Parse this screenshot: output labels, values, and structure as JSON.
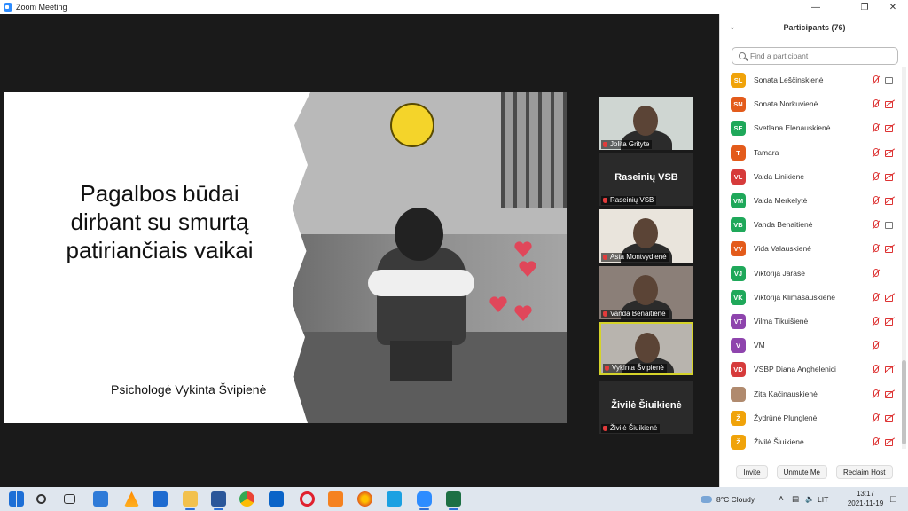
{
  "window": {
    "title": "Zoom Meeting"
  },
  "slide": {
    "heading_lines": [
      "Pagalbos būdai",
      "dirbant su smurtą",
      "patiriančiais vaikai"
    ],
    "author": "Psichologė Vykinta Švipienė"
  },
  "gallery": [
    {
      "name": "Jolita Grityte",
      "type": "video",
      "bg": "#cfd6d2"
    },
    {
      "name": "Raseinių VSB",
      "type": "name",
      "big": "Raseinių VSB"
    },
    {
      "name": "Asta Montvydienė",
      "type": "video",
      "bg": "#e9e4dc"
    },
    {
      "name": "Vanda Benaitienė",
      "type": "video",
      "bg": "#8b7f78"
    },
    {
      "name": "Vykinta Švipienė",
      "type": "video",
      "bg": "#b8b4ae",
      "active": true
    },
    {
      "name": "Živilė Šiuikienė",
      "type": "name",
      "big": "Živilė Šiuikienė"
    }
  ],
  "panel": {
    "title": "Participants (76)",
    "search_placeholder": "Find a participant",
    "participants": [
      {
        "initials": "SL",
        "name": "Sonata Leščinskienė",
        "color": "#f0a30a",
        "cam": "on"
      },
      {
        "initials": "SN",
        "name": "Sonata Norkuvienė",
        "color": "#e35b1b",
        "cam": "off"
      },
      {
        "initials": "SE",
        "name": "Svetlana Elenauskienė",
        "color": "#1fa85a",
        "cam": "off"
      },
      {
        "initials": "T",
        "name": "Tamara",
        "color": "#e35b1b",
        "cam": "off"
      },
      {
        "initials": "VL",
        "name": "Vaida Linikienė",
        "color": "#d63b3b",
        "cam": "off"
      },
      {
        "initials": "VM",
        "name": "Vaida Merkelytė",
        "color": "#1fa85a",
        "cam": "off"
      },
      {
        "initials": "VB",
        "name": "Vanda Benaitienė",
        "color": "#1fa85a",
        "cam": "on"
      },
      {
        "initials": "VV",
        "name": "Vida Valauskienė",
        "color": "#e35b1b",
        "cam": "off"
      },
      {
        "initials": "VJ",
        "name": "Viktorija Jarašė",
        "color": "#1fa85a",
        "cam": "none"
      },
      {
        "initials": "VK",
        "name": "Viktorija Klimašauskienė",
        "color": "#1fa85a",
        "cam": "off"
      },
      {
        "initials": "VT",
        "name": "Vilma Tikuišienė",
        "color": "#8e44ad",
        "cam": "off"
      },
      {
        "initials": "V",
        "name": "VM",
        "color": "#8e44ad",
        "cam": "none"
      },
      {
        "initials": "VD",
        "name": "VSBP Diana Anghelenici",
        "color": "#d63b3b",
        "cam": "off"
      },
      {
        "initials": "",
        "name": "Zita Kačinauskienė",
        "color": "#b08a6e",
        "cam": "off"
      },
      {
        "initials": "Ž",
        "name": "Žydrūnė Plunglenė",
        "color": "#f0a30a",
        "cam": "off"
      },
      {
        "initials": "Ž",
        "name": "Živilė Šiuikienė",
        "color": "#f0a30a",
        "cam": "off"
      }
    ],
    "buttons": {
      "invite": "Invite",
      "unmute": "Unmute Me",
      "reclaim": "Reclaim Host"
    }
  },
  "taskbar": {
    "weather": "8°C  Cloudy",
    "lang": "LIT",
    "time": "13:17",
    "date": "2021-11-19"
  }
}
